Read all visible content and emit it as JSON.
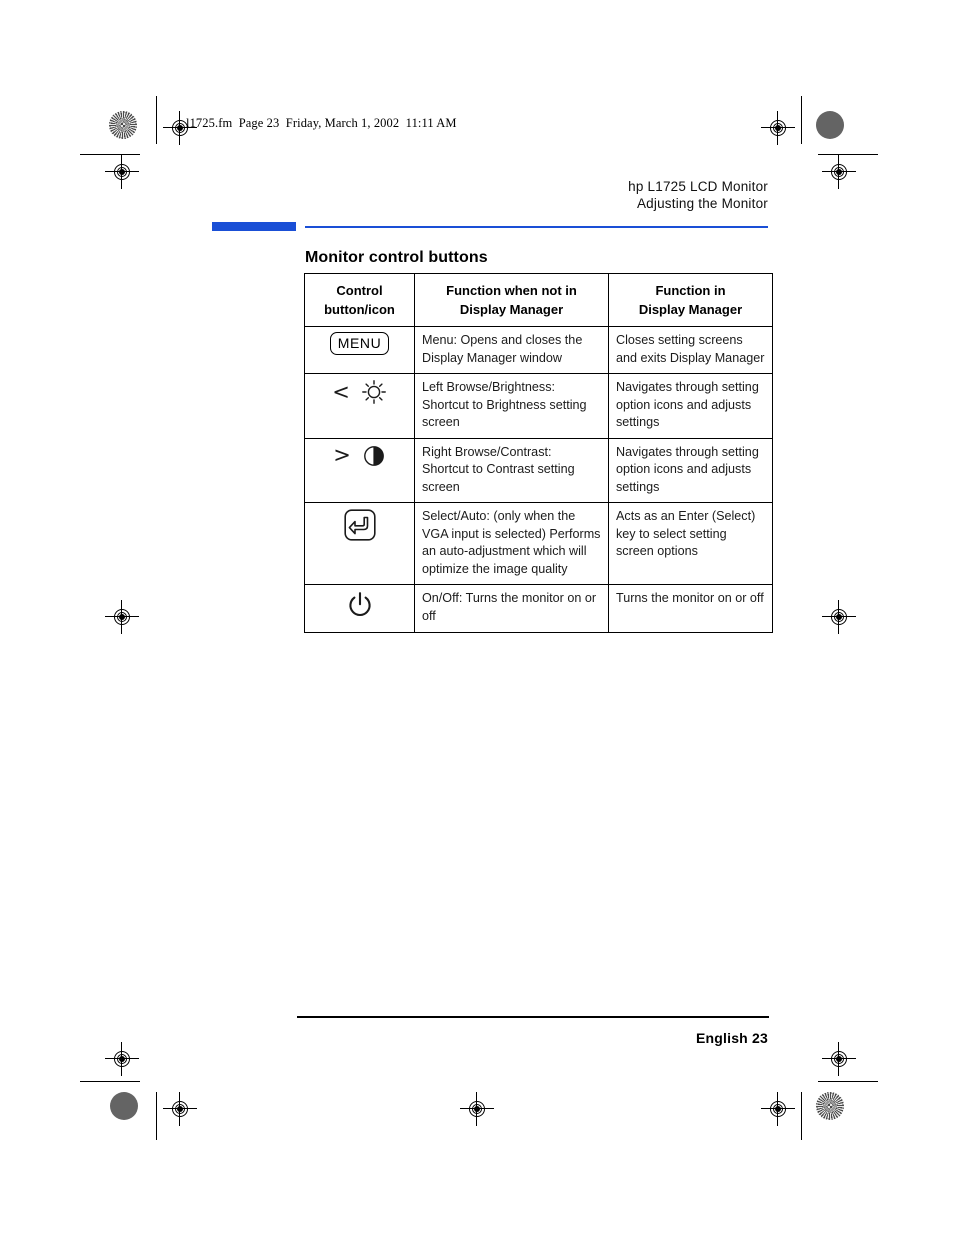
{
  "page": {
    "file_stamp": "l1725.fm  Page 23  Friday, March 1, 2002  11:11 AM",
    "running_head_line1": "hp L1725 LCD Monitor",
    "running_head_line2": "Adjusting the Monitor",
    "section_heading": "Monitor control buttons",
    "footer": "English 23",
    "accent_color": "#1a4fd6",
    "rule_color": "#000000"
  },
  "table": {
    "headers": [
      "Control\nbutton/icon",
      "Function when not in\nDisplay Manager",
      "Function in\nDisplay Manager"
    ],
    "headers_flat": {
      "col1_line1": "Control",
      "col1_line2": "button/icon",
      "col2_line1": "Function when not in",
      "col2_line2": "Display Manager",
      "col3_line1": "Function in",
      "col3_line2": "Display Manager"
    },
    "rows": [
      {
        "icon": "menu-button-icon",
        "icon_label": "MENU",
        "not_in_dm": "Menu: Opens and closes the Display Manager window",
        "in_dm": "Closes setting screens and exits Display Manager"
      },
      {
        "icon": "left-browse-brightness-icon",
        "icon_label": "",
        "not_in_dm": "Left Browse/Brightness: Shortcut to Brightness setting screen",
        "in_dm": "Navigates through setting option icons and adjusts settings"
      },
      {
        "icon": "right-browse-contrast-icon",
        "icon_label": "",
        "not_in_dm": "Right Browse/Contrast: Shortcut to Contrast setting screen",
        "in_dm": "Navigates through setting option icons and adjusts settings"
      },
      {
        "icon": "select-auto-enter-icon",
        "icon_label": "",
        "not_in_dm": "Select/Auto: (only when the VGA input is selected) Performs an auto-adjustment which will optimize the image quality",
        "in_dm": "Acts as an Enter (Select) key to select setting screen options"
      },
      {
        "icon": "power-on-off-icon",
        "icon_label": "",
        "not_in_dm": "On/Off: Turns the monitor on or off",
        "in_dm": "Turns the monitor on or off"
      }
    ]
  }
}
